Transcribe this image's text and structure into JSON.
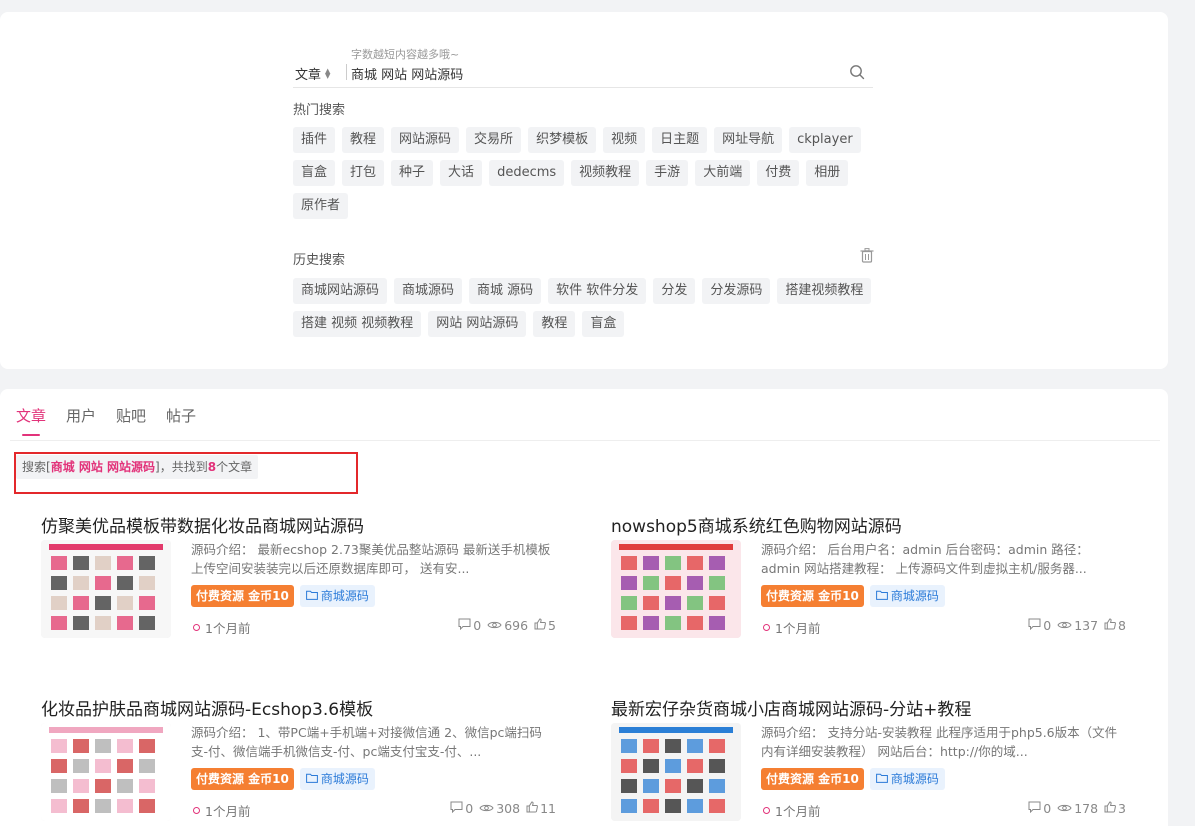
{
  "search": {
    "type_label": "文章",
    "hint": "字数越短内容越多哦~",
    "query": "商城 网站 网站源码"
  },
  "hot": {
    "title": "热门搜索",
    "tags": [
      "插件",
      "教程",
      "网站源码",
      "交易所",
      "织梦模板",
      "视频",
      "日主题",
      "网址导航",
      "ckplayer",
      "盲盒",
      "打包",
      "种子",
      "大话",
      "dedecms",
      "视频教程",
      "手游",
      "大前端",
      "付费",
      "相册",
      "原作者"
    ]
  },
  "history": {
    "title": "历史搜索",
    "tags": [
      "商城网站源码",
      "商城源码",
      "商城 源码",
      "软件 软件分发",
      "分发",
      "分发源码",
      "搭建视频教程",
      "搭建 视频 视频教程",
      "网站 网站源码",
      "教程",
      "盲盒"
    ]
  },
  "tabs": [
    "文章",
    "用户",
    "贴吧",
    "帖子"
  ],
  "result_summary": {
    "prefix": "搜索[",
    "keyword": "商城 网站 网站源码",
    "middle": "]，共找到",
    "count": "8",
    "suffix": "个文章"
  },
  "posts": [
    {
      "title": "仿聚美优品模板带数据化妆品商城网站源码",
      "excerpt": "源码介绍： 最新ecshop 2.73聚美优品整站源码 最新送手机模板 上传空间安装装完以后还原数据库即可， 送有安...",
      "paid_label": "付费资源 金币10",
      "category": "商城源码",
      "time": "1个月前",
      "comments": "0",
      "views": "696",
      "likes": "5"
    },
    {
      "title": "nowshop5商城系统红色购物网站源码",
      "excerpt": "源码介绍： 后台用户名：admin 后台密码：admin 路径：admin 网站搭建教程： 上传源码文件到虚拟主机/服务器...",
      "paid_label": "付费资源 金币10",
      "category": "商城源码",
      "time": "1个月前",
      "comments": "0",
      "views": "137",
      "likes": "8"
    },
    {
      "title": "化妆品护肤品商城网站源码-Ecshop3.6模板",
      "excerpt": "源码介绍： 1、带PC端+手机端+对接微信通 2、微信pc端扫码支-付、微信端手机微信支-付、pc端支付宝支-付、...",
      "paid_label": "付费资源 金币10",
      "category": "商城源码",
      "time": "1个月前",
      "comments": "0",
      "views": "308",
      "likes": "11"
    },
    {
      "title": "最新宏仔杂货商城小店商城网站源码-分站+教程",
      "excerpt": "源码介绍： 支持分站-安装教程 此程序适用于php5.6版本（文件内有详细安装教程） 网站后台：http://你的域...",
      "paid_label": "付费资源 金币10",
      "category": "商城源码",
      "time": "1个月前",
      "comments": "0",
      "views": "178",
      "likes": "3"
    }
  ]
}
